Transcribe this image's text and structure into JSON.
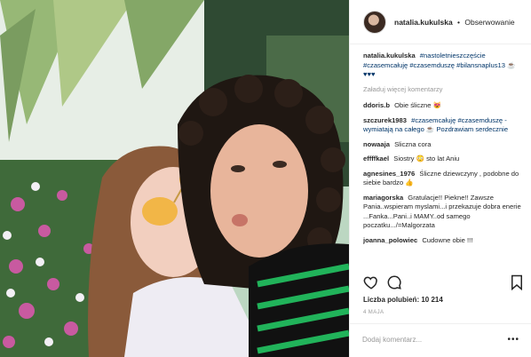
{
  "post": {
    "username": "natalia.kukulska",
    "separator": "•",
    "follow_label": "Obserwowanie"
  },
  "caption": {
    "username": "natalia.kukulska",
    "text": "#nastoletnieszczęście #czasemcałuję #czasemduszę #bilansnaplus13 ☕♥♥♥"
  },
  "load_more_label": "Załaduj więcej komentarzy",
  "comments": [
    {
      "user": "ddoris.b",
      "text": "Obie śliczne 😻"
    },
    {
      "user": "szczurek1983",
      "text": "#czasemcałuję #czasemduszę - wymiatają na całego ☕ Pozdrawiam serdecznie"
    },
    {
      "user": "nowaaja",
      "text": "Sliczna cora"
    },
    {
      "user": "effffkael",
      "text": "Siostry 😳 sto lat Aniu"
    },
    {
      "user": "agnesines_1976",
      "text": "Śliczne dziewczyny , podobne do siebie bardzo 👍"
    },
    {
      "user": "mariagorska",
      "text": "Gratulacje!! Piekne!! Zawsze Pania..wspieram myslami...i przekazuje dobra enerie ...Fanka...Pani..i MAMY..od samego poczatku.../=Malgorzata"
    },
    {
      "user": "joanna_polowiec",
      "text": "Cudowne obie !!!"
    }
  ],
  "actions": {
    "like_icon": "heart-icon",
    "comment_icon": "comment-icon",
    "save_icon": "bookmark-icon"
  },
  "likes_text": "Liczba polubień: 10 214",
  "date_text": "4 MAJA",
  "add_comment_placeholder": "Dodaj komentarz...",
  "more_label": "•••",
  "colors": {
    "hashtag": "#003569",
    "muted": "#999999",
    "border": "#efefef"
  }
}
